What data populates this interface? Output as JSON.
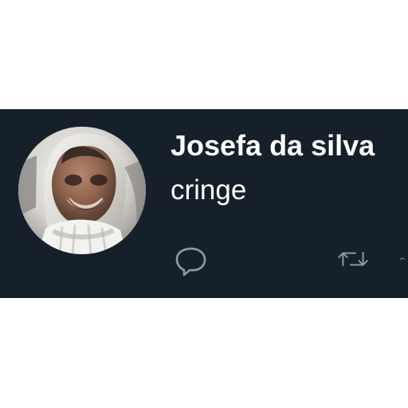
{
  "tweet": {
    "display_name": "Josefa da silva",
    "text": "cringe",
    "avatar_icon": "profile-photo",
    "actions": {
      "reply_icon": "reply-icon",
      "retweet_icon": "retweet-icon",
      "next_icon": "heart-icon-partial"
    }
  },
  "colors": {
    "page_background": "#ffffff",
    "tweet_background": "#15202b",
    "text": "#ffffff",
    "action_icons": "#8899a6"
  }
}
